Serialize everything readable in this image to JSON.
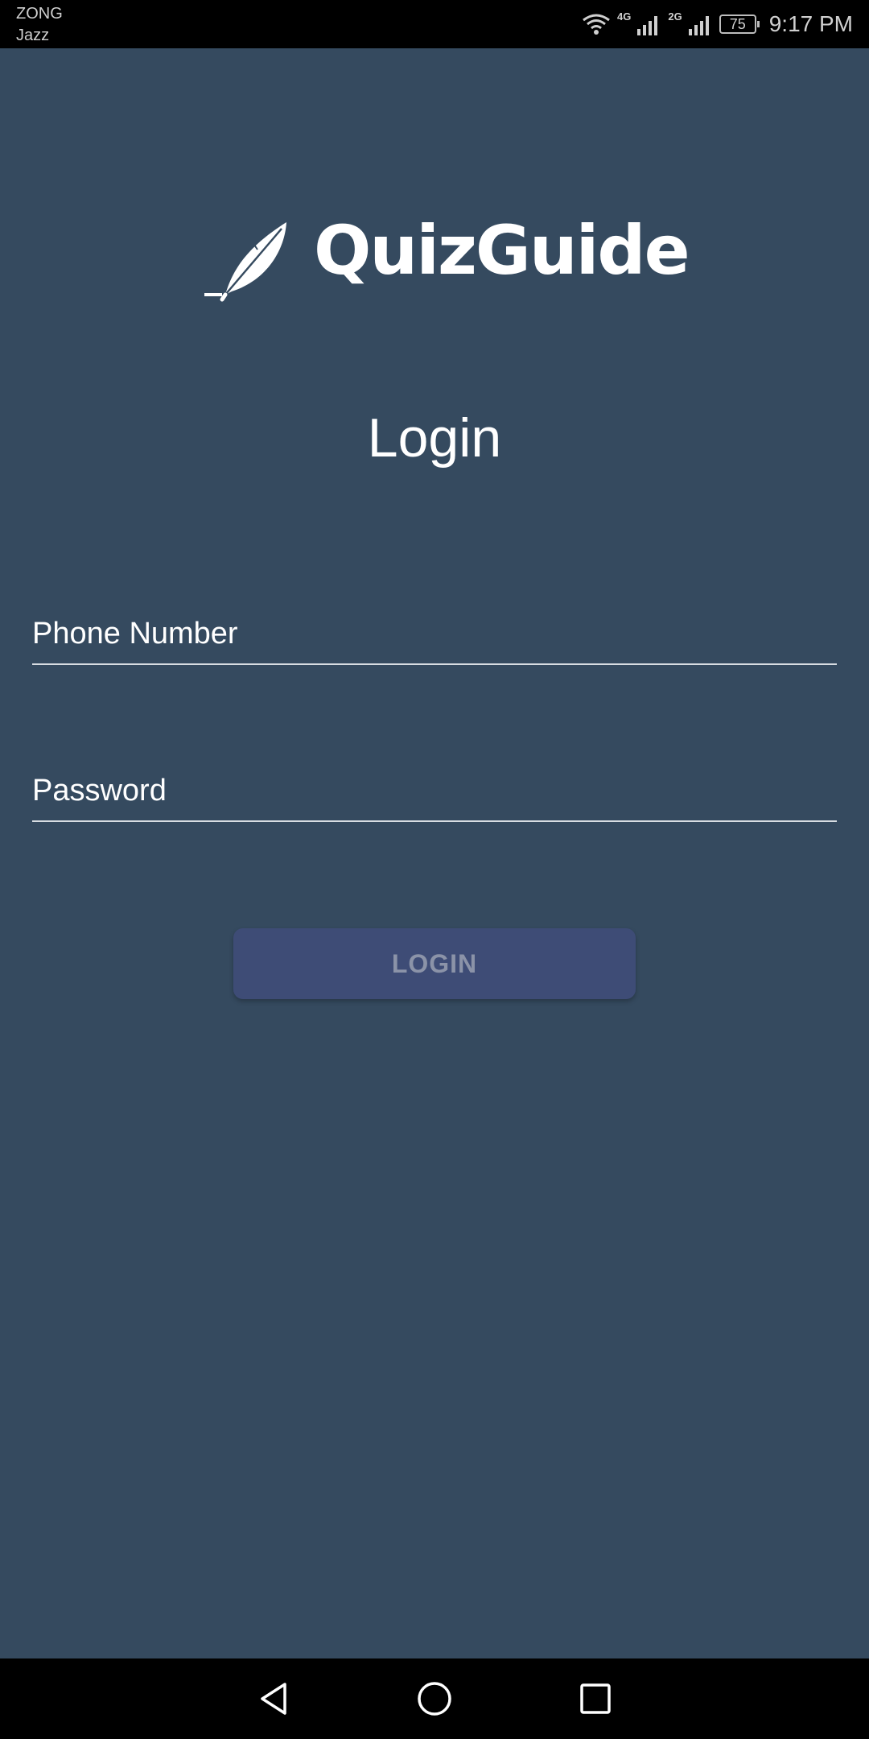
{
  "status_bar": {
    "carrier_1": "ZONG",
    "carrier_2": "Jazz",
    "net_1": "4G",
    "net_2": "2G",
    "battery": "75",
    "time": "9:17 PM"
  },
  "logo": {
    "text": "QuizGuide",
    "icon": "feather-quill-icon"
  },
  "page": {
    "title": "Login"
  },
  "form": {
    "phone_placeholder": "Phone Number",
    "phone_value": "",
    "password_placeholder": "Password",
    "password_value": "",
    "login_label": "LOGIN"
  },
  "nav_bar": {
    "back_icon": "back-triangle-icon",
    "home_icon": "home-circle-icon",
    "recent_icon": "recent-square-icon"
  },
  "colors": {
    "background": "#354a5f",
    "button": "#3e4c76",
    "button_text": "#8b93a8"
  }
}
